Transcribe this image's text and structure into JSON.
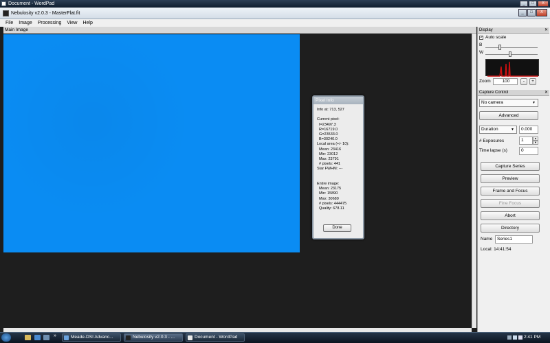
{
  "wordpad_window": {
    "title": "Document - WordPad",
    "buttons": [
      "_",
      "□",
      "X"
    ]
  },
  "app": {
    "title": "Nebulosity v2.0.3 - MasterFlat.fit",
    "window_buttons": [
      "_",
      "□",
      "X"
    ]
  },
  "menu": [
    "File",
    "Image",
    "Processing",
    "View",
    "Help"
  ],
  "main_image": {
    "header": "Main Image",
    "image_color": "#0a8cf3"
  },
  "pixel_info": {
    "title": "Pixel Info",
    "lines": [
      "Info at: 713, 527",
      "",
      "Current pixel:",
      "  I=23497.3",
      "  R=16719.0",
      "  G=23533.0",
      "  B=30240.0",
      "Local area (+/- 10):",
      "  Mean: 23416",
      "  Min: 23012",
      "  Max: 23791",
      "  # pixels: 441",
      "Star FWHM: ---",
      "",
      "",
      "Entire image:",
      "  Mean: 23175",
      "  Min: 15890",
      "  Max: 30689",
      "  # pixels: 444475",
      "  Quality: 678.11"
    ],
    "done_label": "Done"
  },
  "display_panel": {
    "header": "Display",
    "auto_scale_label": "Auto scale",
    "auto_scale_checked": true,
    "b_label": "B",
    "w_label": "W",
    "zoom_label": "Zoom",
    "zoom_value": "100",
    "zoom_minus": "-",
    "zoom_plus": "+"
  },
  "capture_panel": {
    "header": "Capture Control",
    "camera_select": "No camera",
    "advanced_label": "Advanced",
    "duration_select": "Duration",
    "duration_value": "0.000",
    "exposures_label": "# Exposures",
    "exposures_value": "1",
    "time_lapse_label": "Time lapse (s)",
    "time_lapse_value": "0",
    "capture_series_label": "Capture Series",
    "preview_label": "Preview",
    "frame_focus_label": "Frame and Focus",
    "fine_focus_label": "Fine Focus",
    "abort_label": "Abort",
    "directory_label": "Directory",
    "name_label": "Name",
    "name_value": "Series1",
    "local_time": "Local: 14:41:54"
  },
  "taskbar": {
    "tasks": [
      {
        "label": "Meade-DSI Advanc...",
        "active": false
      },
      {
        "label": "Nebulosity v2.0.3 - ...",
        "active": true
      },
      {
        "label": "Document - WordPad",
        "active": false
      }
    ],
    "overflow": "»",
    "clock": "2:41 PM"
  },
  "colors": {
    "image_blue": "#0a8cf3",
    "background_dark": "#1e1e1e",
    "histogram_peaks": "#cc1010"
  }
}
